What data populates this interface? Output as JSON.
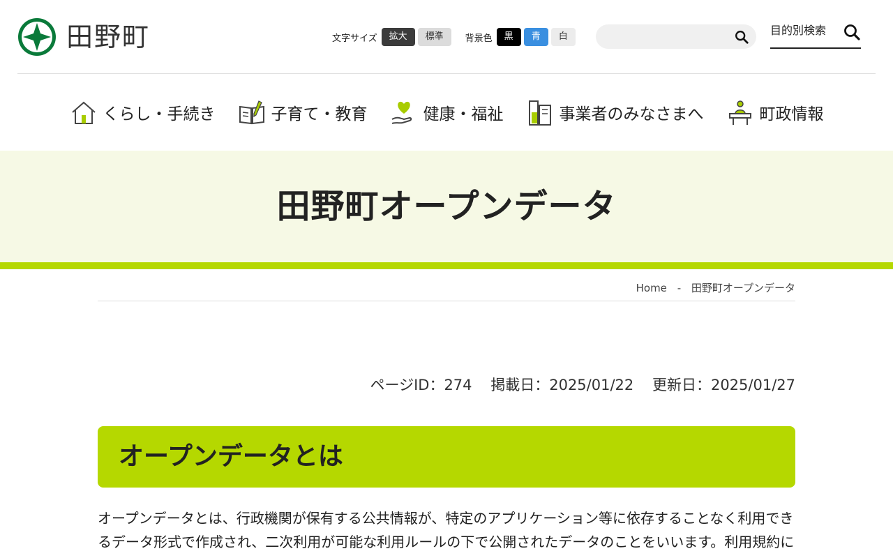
{
  "site": {
    "name": "田野町",
    "logo_icon": "town-emblem"
  },
  "text_size": {
    "label": "文字サイズ",
    "large": "拡大",
    "normal": "標準"
  },
  "background": {
    "label": "背景色",
    "black": "黒",
    "blue": "青",
    "white": "白"
  },
  "search": {
    "placeholder": "",
    "icon": "search-icon"
  },
  "purpose_search": {
    "label": "目的別検索"
  },
  "nav": [
    {
      "label": "くらし・手続き",
      "icon": "house-icon"
    },
    {
      "label": "子育て・教育",
      "icon": "book-pencil-icon"
    },
    {
      "label": "健康・福祉",
      "icon": "heart-hand-icon"
    },
    {
      "label": "事業者のみなさまへ",
      "icon": "building-icon"
    },
    {
      "label": "町政情報",
      "icon": "podium-icon"
    }
  ],
  "page": {
    "title": "田野町オープンデータ"
  },
  "breadcrumb": {
    "home": "Home",
    "separator": "-",
    "current": "田野町オープンデータ"
  },
  "meta": {
    "page_id": "ページID：274",
    "published": "掲載日：2025/01/22",
    "updated": "更新日：2025/01/27"
  },
  "section": {
    "heading": "オープンデータとは",
    "body": "オープンデータとは、行政機関が保有する公共情報が、特定のアプリケーション等に依存することなく利用できるデータ形式で作成され、二次利用が可能な利用ルールの下で公開されたデータのことをいいます。利用規約に定める"
  },
  "colors": {
    "accent": "#b5d800",
    "band": "#f6f9e5",
    "brand_green": "#0a7a3a",
    "blue": "#3a8fe0"
  }
}
